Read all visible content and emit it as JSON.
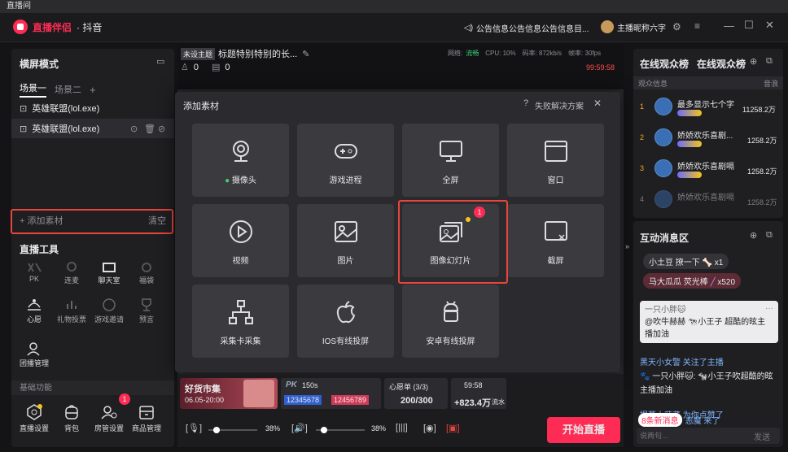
{
  "os_title": "直播间",
  "app": {
    "brand": "直播伴侣",
    "platform": "· 抖音",
    "notice": "公告信息公告信息公告信息目...",
    "user": "主播昵称六字"
  },
  "left": {
    "mode_title": "横屏模式",
    "scenes": [
      "场景一",
      "场景二",
      "+"
    ],
    "sources": [
      "英雄联盟(lol.exe)",
      "英雄联盟(lol.exe)"
    ],
    "add_material": "+ 添加素材",
    "clear": "清空",
    "tools_title": "直播工具",
    "tools_row1": [
      "PK",
      "连麦",
      "聊天室",
      "福袋"
    ],
    "tools_row2": [
      "心愿",
      "礼物投票",
      "游戏邀请",
      "预言"
    ],
    "tools_row3": [
      "团播管理"
    ],
    "basic_title": "基础功能",
    "basic": [
      "直播设置",
      "背包",
      "房管设置",
      "商品管理"
    ],
    "basic_badge": "1"
  },
  "stage": {
    "tag": "未设主题",
    "title": "标题特别特别的长...",
    "viewers": "0",
    "likes": "0",
    "network": "网络:",
    "network_state": "流畅",
    "cpu": "CPU: 10%",
    "bitrate": "码率: 872kb/s",
    "fps": "帧率: 30fps",
    "timer": "99:59:58"
  },
  "dialog": {
    "title": "添加素材",
    "help": "失败解决方案",
    "close": "✕",
    "tiles": [
      "摄像头",
      "游戏进程",
      "全屏",
      "窗口",
      "视频",
      "图片",
      "图像幻灯片",
      "截屏",
      "采集卡采集",
      "IOS有线投屏",
      "安卓有线投屏"
    ],
    "slide_badge": "1"
  },
  "bottom": {
    "shop_title": "好货市集",
    "shop_time": "06.05-20:00",
    "pk_score": "150s",
    "pk_left": "12345678",
    "pk_right": "12456789",
    "wish": "心愿单 (3/3)",
    "wish_val": "200/300",
    "rev_time": "59:58",
    "rev_val": "+823.4万",
    "rev_unit": "流水",
    "mic_pct": "38%",
    "spk_pct": "38%",
    "start": "开始直播"
  },
  "right": {
    "rank_tabs": [
      "在线观众榜",
      "在线观众榜"
    ],
    "rank_header": "观众信息",
    "rank_header_right": "音浪",
    "ranks": [
      {
        "n": "1",
        "name": "最多显示七个字",
        "val": "11258.2万"
      },
      {
        "n": "2",
        "name": "娇娇欢乐喜剧...",
        "val": "1258.2万"
      },
      {
        "n": "3",
        "name": "娇娇欢乐喜剧嗝",
        "val": "1258.2万"
      },
      {
        "n": "4",
        "name": "娇娇欢乐喜剧嗝",
        "val": "1258.2万"
      }
    ],
    "interact_title": "互动消息区",
    "gifts": [
      {
        "user": "小土豆",
        "act": "撩一下",
        "count": "x1"
      },
      {
        "user": "马大瓜瓜",
        "act": "荧光棒",
        "count": "x520"
      }
    ],
    "msg_box_user": "一只小胖🐱",
    "msg_box_text": "@吹牛赫赫 🐄小王子 超酷的昡主播加油",
    "msgs": [
      "黑天小女警 关注了主播",
      "🐾 一只小胖🐱: 🐄小王子吹超酷的昡主播加油",
      "提莫小菠菜 为你点赞了",
      "恶魔 来了"
    ],
    "new_msg": "8条新消息",
    "input_placeholder": "说两句...",
    "send": "发送"
  },
  "colors": {
    "accent": "#fe2c55",
    "box": "#e8453c",
    "live": "#ff4d4f"
  }
}
